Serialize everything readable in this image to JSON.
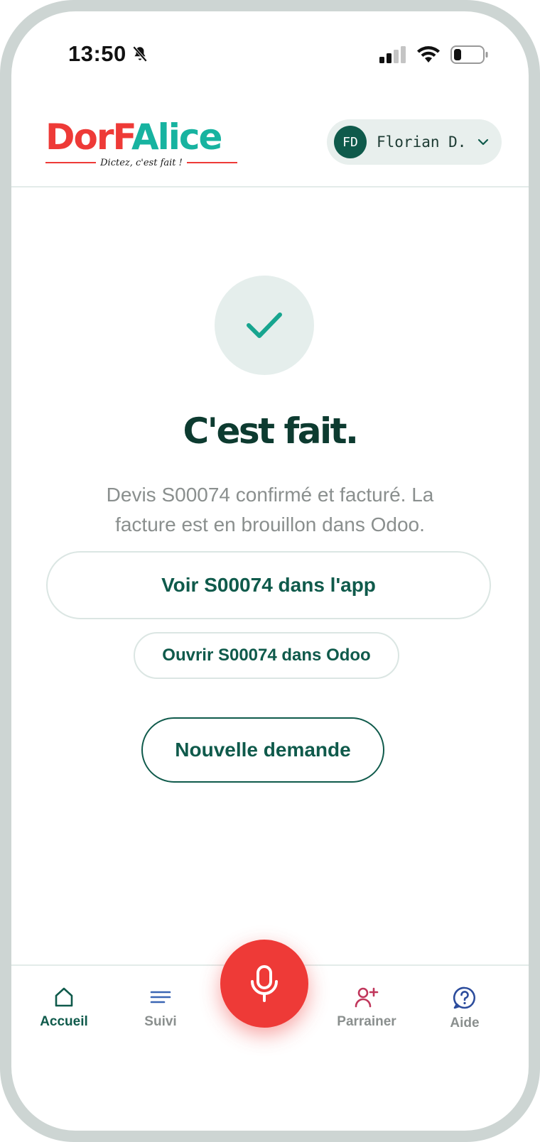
{
  "status_bar": {
    "time": "13:50"
  },
  "header": {
    "logo_part1": "DorF",
    "logo_part2": "Alice",
    "logo_tagline": "Dictez, c'est fait !",
    "user": {
      "initials": "FD",
      "name": "Florian D."
    }
  },
  "main": {
    "title": "C'est fait.",
    "message": "Devis S00074 confirmé et facturé. La facture est en brouillon dans Odoo.",
    "btn_view_app": "Voir S00074 dans l'app",
    "btn_open_odoo": "Ouvrir S00074 dans Odoo",
    "btn_new_request": "Nouvelle demande"
  },
  "nav": {
    "items": [
      {
        "label": "Accueil",
        "icon": "home-icon",
        "active": true
      },
      {
        "label": "Suivi",
        "icon": "list-icon",
        "active": false
      },
      {
        "label": "Parrainer",
        "icon": "user-plus-icon",
        "active": false
      },
      {
        "label": "Aide",
        "icon": "help-icon",
        "active": false
      }
    ]
  },
  "colors": {
    "brand_green": "#0f5a4b",
    "brand_red": "#ee3a37",
    "logo_teal": "#17b3a0",
    "suivi_icon": "#3b66b4",
    "parrainer_icon": "#c0365b",
    "aide_icon": "#2c4c9c"
  }
}
